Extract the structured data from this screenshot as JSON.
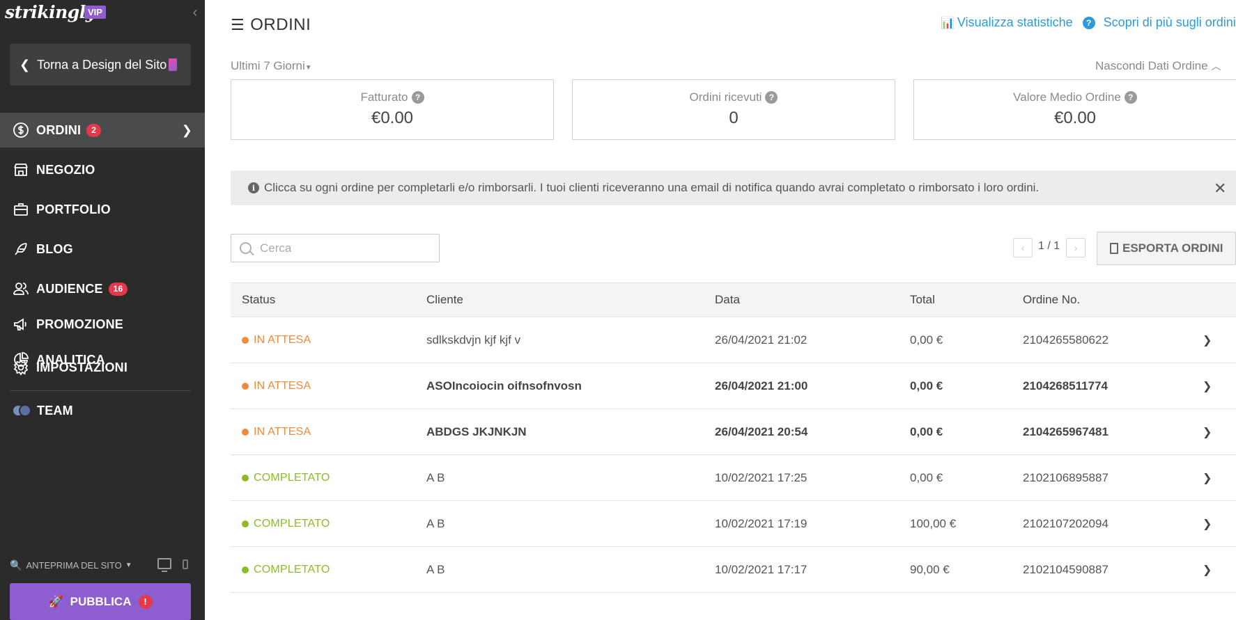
{
  "colors": {
    "sidebar_bg": "#2b2b2c",
    "accent_purple": "#8e5ed0",
    "badge_red": "#e5394b",
    "link_blue": "#2e9ad8",
    "pending_orange": "#f08a3c",
    "completed_green": "#8cbb2a"
  },
  "sidebar": {
    "logo": "strikingly",
    "vip_badge": "VIP",
    "back_button": "Torna a Design del Sito",
    "items": [
      {
        "label": "ORDINI",
        "badge": "2",
        "icon": "dollar-circle-icon"
      },
      {
        "label": "NEGOZIO",
        "icon": "store-icon"
      },
      {
        "label": "PORTFOLIO",
        "icon": "briefcase-icon"
      },
      {
        "label": "BLOG",
        "icon": "feather-icon"
      },
      {
        "label": "AUDIENCE",
        "badge": "16",
        "icon": "users-icon"
      },
      {
        "label": "PROMOZIONE",
        "icon": "megaphone-icon"
      },
      {
        "label": "ANALITICA",
        "icon": "pie-chart-icon"
      },
      {
        "label": "IMPOSTAZIONI",
        "icon": "gear-icon"
      }
    ],
    "team_label": "TEAM",
    "preview_label": "ANTEPRIMA DEL SITO",
    "publish_label": "PUBBLICA",
    "publish_alert": "!"
  },
  "header": {
    "title": "ORDINI",
    "stats_link": "Visualizza statistiche",
    "learn_link": "Scopri di più sugli ordini",
    "help_icon_text": "?"
  },
  "filters": {
    "range": "Ultimi 7 Giorni",
    "hide_data": "Nascondi Dati Ordine"
  },
  "stats": [
    {
      "label": "Fatturato",
      "value": "€0.00"
    },
    {
      "label": "Ordini ricevuti",
      "value": "0"
    },
    {
      "label": "Valore Medio Ordine",
      "value": "€0.00"
    }
  ],
  "banner": {
    "text": "Clicca su ogni ordine per completarli e/o rimborsarli. I tuoi clienti riceveranno una email di notifica quando avrai completato o rimborsato i loro ordini."
  },
  "search": {
    "placeholder": "Cerca"
  },
  "pagination": {
    "label": "1 / 1"
  },
  "export_label": "ESPORTA ORDINI",
  "table": {
    "headers": [
      "Status",
      "Cliente",
      "Data",
      "Total",
      "Ordine No."
    ],
    "rows": [
      {
        "status": "IN ATTESA",
        "cliente": "sdlkskdvjn kjf kjf v",
        "data": "26/04/2021 21:02",
        "total": "0,00 €",
        "ordine": "2104265580622"
      },
      {
        "status": "IN ATTESA",
        "cliente": "ASOIncoiocin oifnsofnvosn",
        "data": "26/04/2021 21:00",
        "total": "0,00 €",
        "ordine": "2104268511774"
      },
      {
        "status": "IN ATTESA",
        "cliente": "ABDGS JKJNKJN",
        "data": "26/04/2021 20:54",
        "total": "0,00 €",
        "ordine": "2104265967481"
      },
      {
        "status": "COMPLETATO",
        "cliente": "A B",
        "data": "10/02/2021 17:25",
        "total": "0,00 €",
        "ordine": "2102106895887"
      },
      {
        "status": "COMPLETATO",
        "cliente": "A B",
        "data": "10/02/2021 17:19",
        "total": "100,00 €",
        "ordine": "2102107202094"
      },
      {
        "status": "COMPLETATO",
        "cliente": "A B",
        "data": "10/02/2021 17:17",
        "total": "90,00 €",
        "ordine": "2102104590887"
      }
    ]
  }
}
